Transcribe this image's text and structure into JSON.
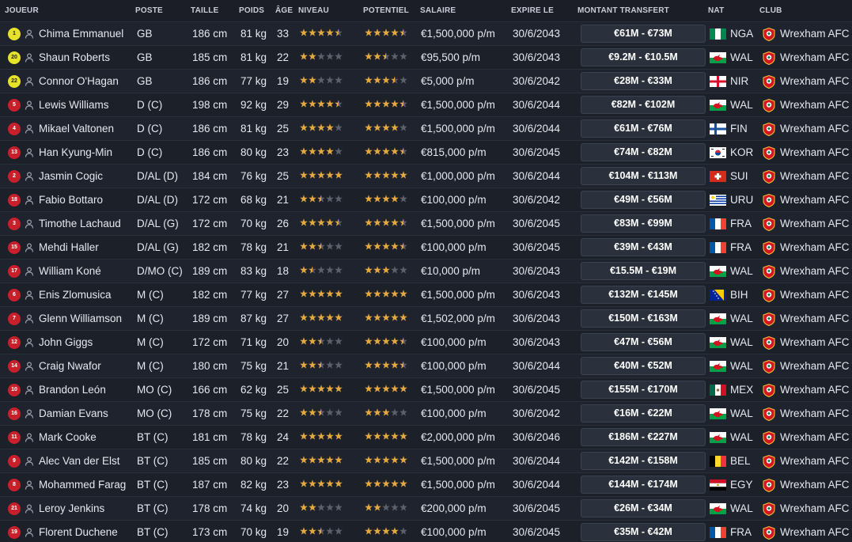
{
  "headers": {
    "player": "JOUEUR",
    "position": "POSTE",
    "height": "TAILLE",
    "weight": "POIDS",
    "age": "ÂGE",
    "ability": "NIVEAU",
    "potential": "POTENTIEL",
    "salary": "SALAIRE",
    "expires": "EXPIRE LE",
    "transfer_value": "MONTANT TRANSFERT",
    "nationality": "NAT",
    "club": "CLUB"
  },
  "colors": {
    "background": "#1b1e27",
    "row_alt": "#1f232d",
    "star_filled": "#e3a83f",
    "star_empty": "#5b606c",
    "fee_box": "#2b313c",
    "shirt_outfield": "#c8202a",
    "shirt_goalkeeper": "#e6e22a"
  },
  "players": [
    {
      "number": "1",
      "gk": true,
      "name": "Chima Emmanuel",
      "position": "GB",
      "height": "186 cm",
      "weight": "81 kg",
      "age": "33",
      "ability": 4.5,
      "potential": 4.5,
      "salary": "€1,500,000 p/m",
      "expires": "30/6/2043",
      "value": "€61M - €73M",
      "nat": "NGA",
      "club": "Wrexham AFC"
    },
    {
      "number": "20",
      "gk": true,
      "name": "Shaun Roberts",
      "position": "GB",
      "height": "185 cm",
      "weight": "81 kg",
      "age": "22",
      "ability": 2,
      "potential": 2.5,
      "salary": "€95,500 p/m",
      "expires": "30/6/2043",
      "value": "€9.2M - €10.5M",
      "nat": "WAL",
      "club": "Wrexham AFC"
    },
    {
      "number": "22",
      "gk": true,
      "name": "Connor O'Hagan",
      "position": "GB",
      "height": "186 cm",
      "weight": "77 kg",
      "age": "19",
      "ability": 2,
      "potential": 3.5,
      "salary": "€5,000 p/m",
      "expires": "30/6/2042",
      "value": "€28M - €33M",
      "nat": "NIR",
      "club": "Wrexham AFC"
    },
    {
      "number": "5",
      "gk": false,
      "name": "Lewis Williams",
      "position": "D (C)",
      "height": "198 cm",
      "weight": "92 kg",
      "age": "29",
      "ability": 4.5,
      "potential": 4.5,
      "salary": "€1,500,000 p/m",
      "expires": "30/6/2044",
      "value": "€82M - €102M",
      "nat": "WAL",
      "club": "Wrexham AFC"
    },
    {
      "number": "4",
      "gk": false,
      "name": "Mikael Valtonen",
      "position": "D (C)",
      "height": "186 cm",
      "weight": "81 kg",
      "age": "25",
      "ability": 4,
      "potential": 4,
      "salary": "€1,500,000 p/m",
      "expires": "30/6/2044",
      "value": "€61M - €76M",
      "nat": "FIN",
      "club": "Wrexham AFC"
    },
    {
      "number": "13",
      "gk": false,
      "name": "Han Kyung-Min",
      "position": "D (C)",
      "height": "186 cm",
      "weight": "80 kg",
      "age": "23",
      "ability": 4,
      "potential": 4.5,
      "salary": "€815,000 p/m",
      "expires": "30/6/2045",
      "value": "€74M - €82M",
      "nat": "KOR",
      "club": "Wrexham AFC"
    },
    {
      "number": "2",
      "gk": false,
      "name": "Jasmin Cogic",
      "position": "D/AL (D)",
      "height": "184 cm",
      "weight": "76 kg",
      "age": "25",
      "ability": 5,
      "potential": 5,
      "salary": "€1,000,000 p/m",
      "expires": "30/6/2044",
      "value": "€104M - €113M",
      "nat": "SUI",
      "club": "Wrexham AFC"
    },
    {
      "number": "18",
      "gk": false,
      "name": "Fabio Bottaro",
      "position": "D/AL (D)",
      "height": "172 cm",
      "weight": "68 kg",
      "age": "21",
      "ability": 2.5,
      "potential": 4,
      "salary": "€100,000 p/m",
      "expires": "30/6/2042",
      "value": "€49M - €56M",
      "nat": "URU",
      "club": "Wrexham AFC"
    },
    {
      "number": "3",
      "gk": false,
      "name": "Timothe Lachaud",
      "position": "D/AL (G)",
      "height": "172 cm",
      "weight": "70 kg",
      "age": "26",
      "ability": 4.5,
      "potential": 4.5,
      "salary": "€1,500,000 p/m",
      "expires": "30/6/2045",
      "value": "€83M - €99M",
      "nat": "FRA",
      "club": "Wrexham AFC"
    },
    {
      "number": "15",
      "gk": false,
      "name": "Mehdi Haller",
      "position": "D/AL (G)",
      "height": "182 cm",
      "weight": "78 kg",
      "age": "21",
      "ability": 2.5,
      "potential": 4.5,
      "salary": "€100,000 p/m",
      "expires": "30/6/2045",
      "value": "€39M - €43M",
      "nat": "FRA",
      "club": "Wrexham AFC"
    },
    {
      "number": "17",
      "gk": false,
      "name": "William Koné",
      "position": "D/MO (C)",
      "height": "189 cm",
      "weight": "83 kg",
      "age": "18",
      "ability": 1.5,
      "potential": 3,
      "salary": "€10,000 p/m",
      "expires": "30/6/2043",
      "value": "€15.5M - €19M",
      "nat": "WAL",
      "club": "Wrexham AFC"
    },
    {
      "number": "6",
      "gk": false,
      "name": "Enis Zlomusica",
      "position": "M (C)",
      "height": "182 cm",
      "weight": "77 kg",
      "age": "27",
      "ability": 5,
      "potential": 5,
      "salary": "€1,500,000 p/m",
      "expires": "30/6/2043",
      "value": "€132M - €145M",
      "nat": "BIH",
      "club": "Wrexham AFC"
    },
    {
      "number": "7",
      "gk": false,
      "name": "Glenn Williamson",
      "position": "M (C)",
      "height": "189 cm",
      "weight": "87 kg",
      "age": "27",
      "ability": 5,
      "potential": 5,
      "salary": "€1,502,000 p/m",
      "expires": "30/6/2043",
      "value": "€150M - €163M",
      "nat": "WAL",
      "club": "Wrexham AFC"
    },
    {
      "number": "12",
      "gk": false,
      "name": "John Giggs",
      "position": "M (C)",
      "height": "172 cm",
      "weight": "71 kg",
      "age": "20",
      "ability": 2.5,
      "potential": 4.5,
      "salary": "€100,000 p/m",
      "expires": "30/6/2043",
      "value": "€47M - €56M",
      "nat": "WAL",
      "club": "Wrexham AFC"
    },
    {
      "number": "14",
      "gk": false,
      "name": "Craig Nwafor",
      "position": "M (C)",
      "height": "180 cm",
      "weight": "75 kg",
      "age": "21",
      "ability": 2.5,
      "potential": 4.5,
      "salary": "€100,000 p/m",
      "expires": "30/6/2044",
      "value": "€40M - €52M",
      "nat": "WAL",
      "club": "Wrexham AFC"
    },
    {
      "number": "10",
      "gk": false,
      "name": "Brandon León",
      "position": "MO (C)",
      "height": "166 cm",
      "weight": "62 kg",
      "age": "25",
      "ability": 5,
      "potential": 5,
      "salary": "€1,500,000 p/m",
      "expires": "30/6/2045",
      "value": "€155M - €170M",
      "nat": "MEX",
      "club": "Wrexham AFC"
    },
    {
      "number": "16",
      "gk": false,
      "name": "Damian Evans",
      "position": "MO (C)",
      "height": "178 cm",
      "weight": "75 kg",
      "age": "22",
      "ability": 2.5,
      "potential": 3,
      "salary": "€100,000 p/m",
      "expires": "30/6/2042",
      "value": "€16M - €22M",
      "nat": "WAL",
      "club": "Wrexham AFC"
    },
    {
      "number": "11",
      "gk": false,
      "name": "Mark Cooke",
      "position": "BT (C)",
      "height": "181 cm",
      "weight": "78 kg",
      "age": "24",
      "ability": 5,
      "potential": 5,
      "salary": "€2,000,000 p/m",
      "expires": "30/6/2046",
      "value": "€186M - €227M",
      "nat": "WAL",
      "club": "Wrexham AFC"
    },
    {
      "number": "9",
      "gk": false,
      "name": "Alec Van der Elst",
      "position": "BT (C)",
      "height": "185 cm",
      "weight": "80 kg",
      "age": "22",
      "ability": 5,
      "potential": 5,
      "salary": "€1,500,000 p/m",
      "expires": "30/6/2044",
      "value": "€142M - €158M",
      "nat": "BEL",
      "club": "Wrexham AFC"
    },
    {
      "number": "8",
      "gk": false,
      "name": "Mohammed Farag",
      "position": "BT (C)",
      "height": "187 cm",
      "weight": "82 kg",
      "age": "23",
      "ability": 5,
      "potential": 5,
      "salary": "€1,500,000 p/m",
      "expires": "30/6/2044",
      "value": "€144M - €174M",
      "nat": "EGY",
      "club": "Wrexham AFC"
    },
    {
      "number": "21",
      "gk": false,
      "name": "Leroy Jenkins",
      "position": "BT (C)",
      "height": "178 cm",
      "weight": "74 kg",
      "age": "20",
      "ability": 2,
      "potential": 2,
      "salary": "€200,000 p/m",
      "expires": "30/6/2045",
      "value": "€26M - €34M",
      "nat": "WAL",
      "club": "Wrexham AFC"
    },
    {
      "number": "19",
      "gk": false,
      "name": "Florent Duchene",
      "position": "BT (C)",
      "height": "173 cm",
      "weight": "70 kg",
      "age": "19",
      "ability": 2.5,
      "potential": 4,
      "salary": "€100,000 p/m",
      "expires": "30/6/2045",
      "value": "€35M - €42M",
      "nat": "FRA",
      "club": "Wrexham AFC"
    }
  ]
}
